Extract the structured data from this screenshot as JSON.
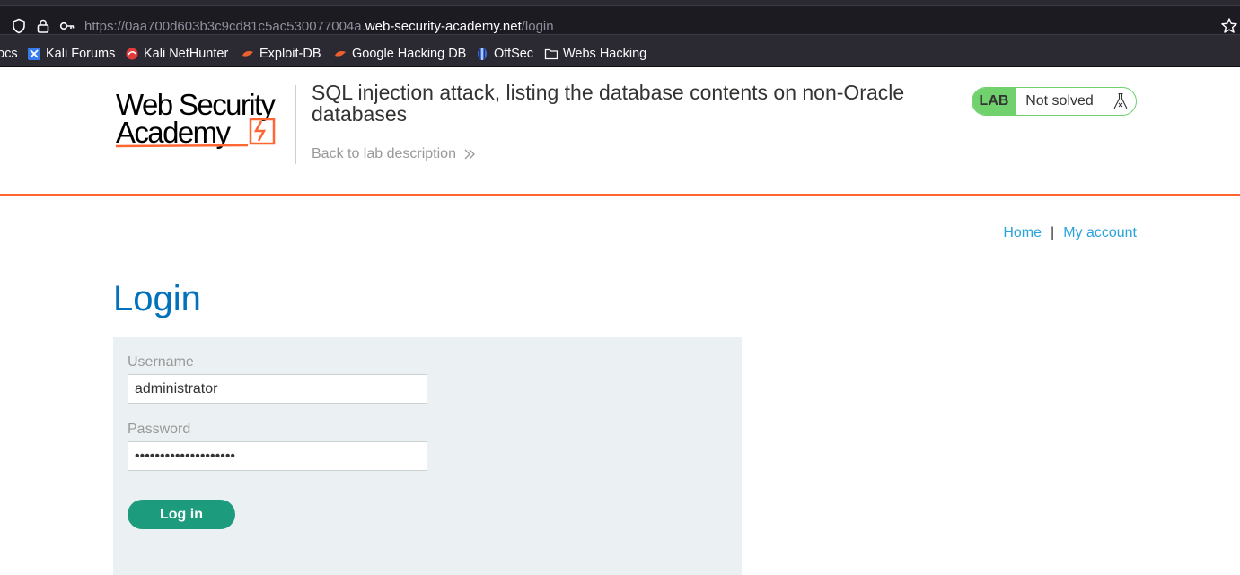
{
  "browser": {
    "url_prefix": "https://0aa700d603b3c9cd81c5ac530077004a.",
    "url_domain": "web-security-academy.net",
    "url_path": "/login"
  },
  "bookmarks": [
    {
      "label": "ocs",
      "icon": "none"
    },
    {
      "label": "Kali Forums",
      "icon": "kali-forums-icon"
    },
    {
      "label": "Kali NetHunter",
      "icon": "kali-nethunter-icon"
    },
    {
      "label": "Exploit-DB",
      "icon": "exploit-db-icon"
    },
    {
      "label": "Google Hacking DB",
      "icon": "ghdb-icon"
    },
    {
      "label": "OffSec",
      "icon": "offsec-icon"
    },
    {
      "label": "Webs Hacking",
      "icon": "folder-icon"
    }
  ],
  "header": {
    "logo_line1": "Web Security",
    "logo_line2": "Academy",
    "lab_title": "SQL injection attack, listing the database contents on non-Oracle databases",
    "back_link": "Back to lab description",
    "lab_badge": "LAB",
    "lab_status": "Not solved"
  },
  "nav": {
    "home": "Home",
    "separator": "|",
    "my_account": "My account"
  },
  "login": {
    "heading": "Login",
    "username_label": "Username",
    "username_value": "administrator",
    "password_label": "Password",
    "password_value": "••••••••••••••••••••",
    "button": "Log in"
  },
  "colors": {
    "accent_orange": "#ff6633",
    "heading_blue": "#0071bc",
    "link_blue": "#29a3d9",
    "lab_green": "#70d16d",
    "button_green": "#1d9b7d"
  }
}
